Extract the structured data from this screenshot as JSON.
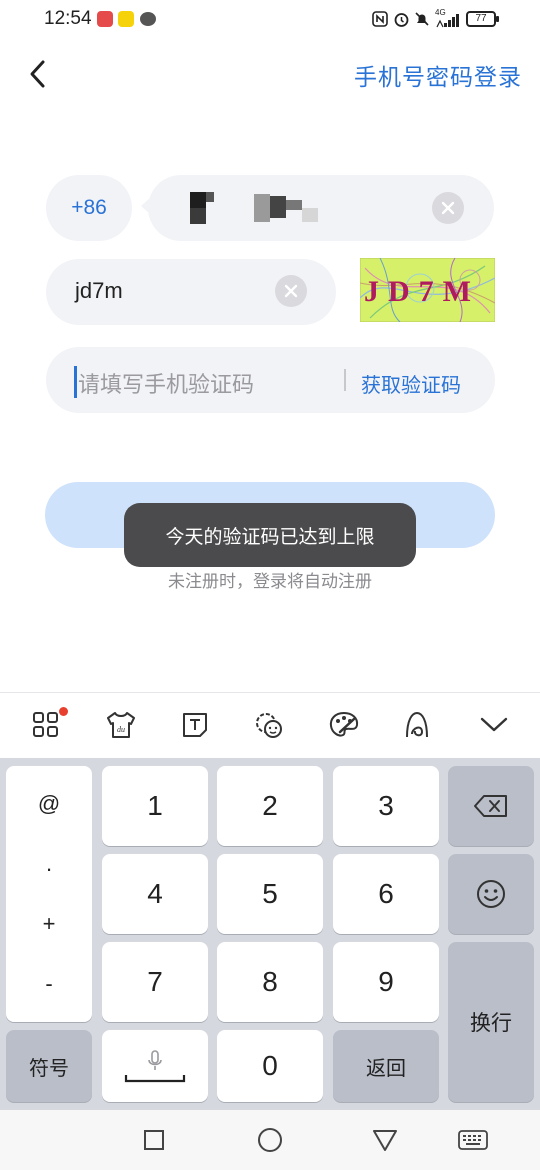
{
  "status_bar": {
    "time": "12:54",
    "network": "4G",
    "battery": "77"
  },
  "header": {
    "back_icon": "chevron-left-icon",
    "password_login_link": "手机号密码登录"
  },
  "form": {
    "country_code": "+86",
    "phone_value": "",
    "captcha_value": "jd7m",
    "captcha_image_text": "JD7M",
    "code_placeholder": "请填写手机验证码",
    "get_code_label": "获取验证码"
  },
  "toast": {
    "message": "今天的验证码已达到上限"
  },
  "auto_register_note": "未注册时，登录将自动注册",
  "keyboard_toolbar": {
    "icons": [
      "apps-grid-icon",
      "skin-shirt-icon",
      "text-t-icon",
      "emoji-settings-icon",
      "palette-icon",
      "handwrite-icon",
      "collapse-chevron-icon"
    ]
  },
  "keyboard": {
    "symbols_column": [
      "@",
      ".",
      "+",
      "-"
    ],
    "digits": [
      "1",
      "2",
      "3",
      "4",
      "5",
      "6",
      "7",
      "8",
      "9",
      "0"
    ],
    "symbols_key": "符号",
    "return_key": "返回",
    "enter_key": "换行"
  },
  "nav_bar": {
    "icons": [
      "square-recents-icon",
      "circle-home-icon",
      "triangle-back-icon",
      "keyboard-switch-icon"
    ]
  },
  "colors": {
    "accent": "#2a73d6",
    "field_bg": "#f2f3f6",
    "login_button_disabled": "#cfe2fb",
    "toast_bg": "#4b4b4d"
  }
}
